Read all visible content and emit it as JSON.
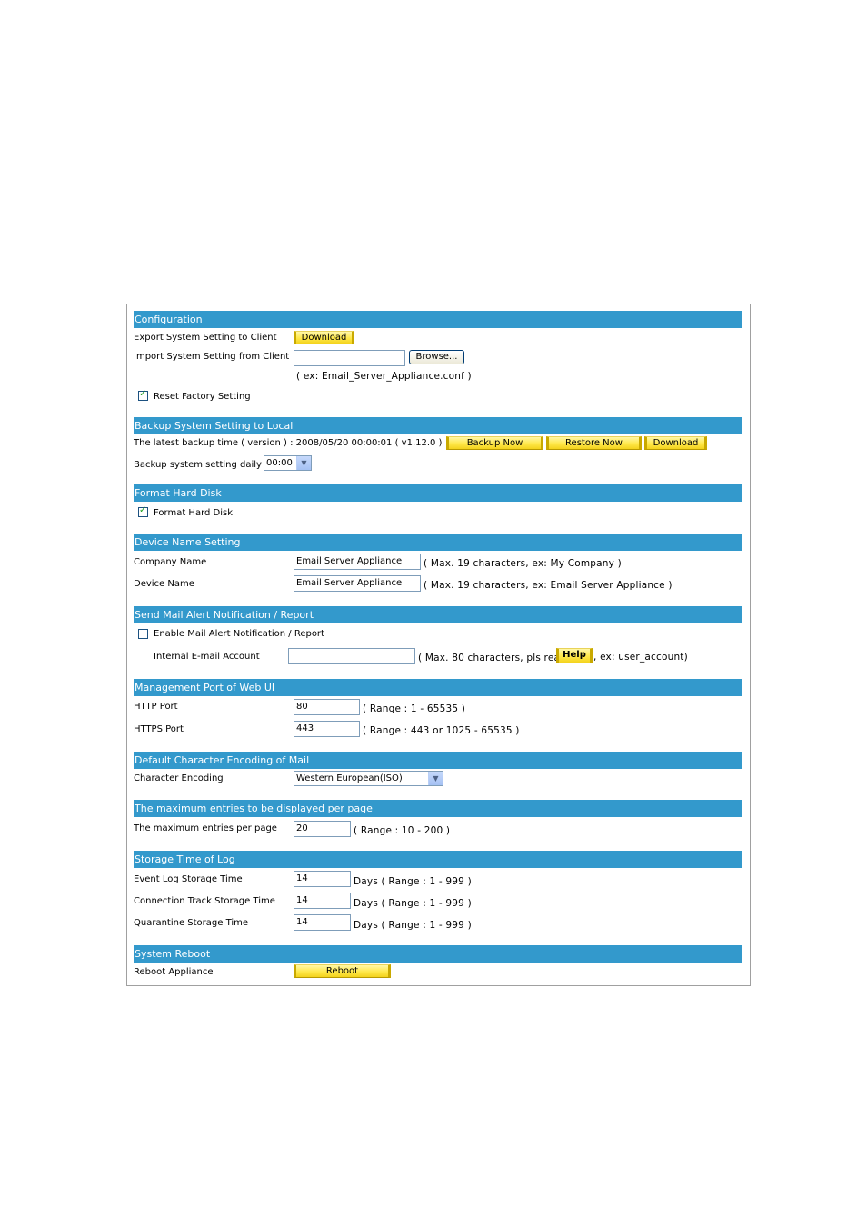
{
  "sections": {
    "configuration": {
      "title": "Configuration",
      "export_label": "Export System Setting to Client",
      "export_button": "Download",
      "import_label": "Import System Setting from Client",
      "import_value": "",
      "browse_button": "Browse...",
      "import_hint": "( ex: Email_Server_Appliance.conf )",
      "reset_label": "Reset Factory Setting",
      "reset_checked": true
    },
    "backup": {
      "title": "Backup System Setting to Local",
      "latest_label": "The latest backup time ( version ) : 2008/05/20 00:00:01 ( v1.12.0 )",
      "backup_now": "Backup Now",
      "restore_now": "Restore Now",
      "download": "Download",
      "daily_label": "Backup system setting daily at",
      "daily_value": "00:00"
    },
    "format": {
      "title": "Format Hard Disk",
      "format_label": "Format Hard Disk",
      "format_checked": true
    },
    "device_name": {
      "title": "Device Name Setting",
      "company_label": "Company Name",
      "company_value": "Email Server Appliance",
      "company_hint": "( Max. 19 characters, ex: My Company )",
      "device_label": "Device Name",
      "device_value": "Email Server Appliance",
      "device_hint": "( Max. 19 characters, ex: Email Server Appliance )"
    },
    "mail_alert": {
      "title": "Send Mail Alert Notification / Report",
      "enable_label": "Enable Mail Alert Notification / Report",
      "enable_checked": false,
      "account_label": "Internal E-mail Account",
      "account_value": "",
      "hint_before": "( Max. 80 characters, pls read",
      "help_button": "Help",
      "hint_after": ", ex: user_account)"
    },
    "mgmt_port": {
      "title": "Management Port of Web UI",
      "http_label": "HTTP Port",
      "http_value": "80",
      "http_hint": "( Range : 1 - 65535 )",
      "https_label": "HTTPS Port",
      "https_value": "443",
      "https_hint": "( Range : 443 or 1025 - 65535 )"
    },
    "encoding": {
      "title": "Default Character Encoding of Mail",
      "label": "Character Encoding",
      "value": "Western European(ISO)"
    },
    "max_entries": {
      "title": "The maximum entries to be displayed per page",
      "label": "The maximum entries per page",
      "value": "20",
      "hint": "( Range : 10 - 200 )"
    },
    "storage": {
      "title": "Storage Time of Log",
      "event_label": "Event Log Storage Time",
      "event_value": "14",
      "event_hint": "Days ( Range : 1 - 999 )",
      "conn_label": "Connection Track Storage Time",
      "conn_value": "14",
      "conn_hint": "Days ( Range : 1 - 999 )",
      "quar_label": "Quarantine Storage Time",
      "quar_value": "14",
      "quar_hint": "Days ( Range : 1 - 999 )"
    },
    "reboot": {
      "title": "System Reboot",
      "label": "Reboot Appliance",
      "button": "Reboot"
    }
  },
  "colors": {
    "header_bg": "#3399cc",
    "button_yellow": "#ffe84a"
  }
}
